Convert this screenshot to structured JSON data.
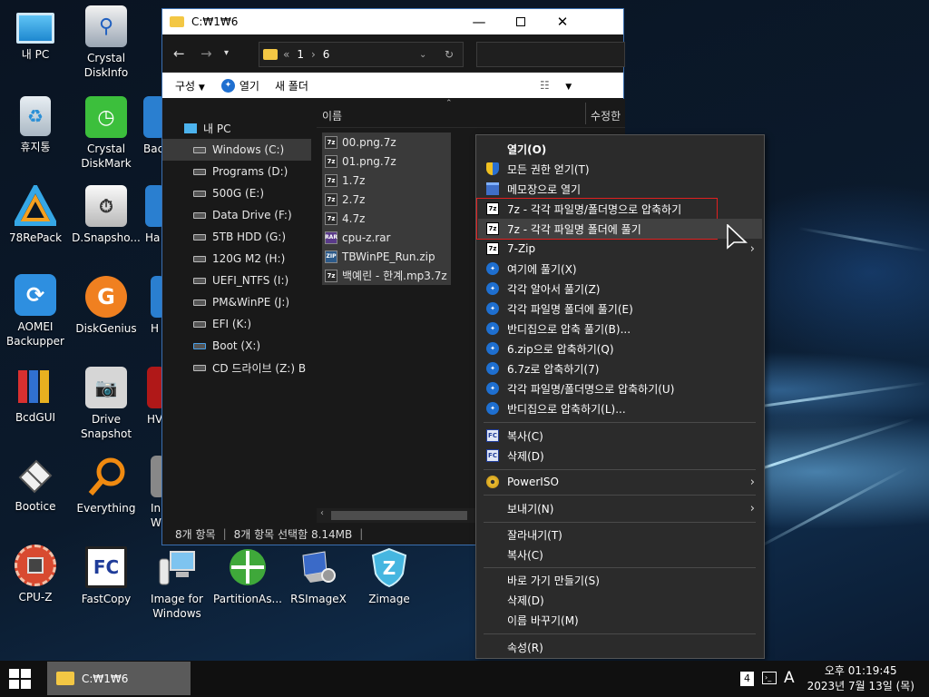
{
  "colors": {
    "accent": "#3b6fb0",
    "highlight_box": "#e02020",
    "menu_bg": "#2b2b2b",
    "selected_item": "#3a3a3a",
    "taskbar_item": "#5a5a5a"
  },
  "desktop_icons": [
    {
      "label": "내 PC",
      "icon": "monitor-icon"
    },
    {
      "label": "Crystal\nDiskInfo",
      "icon": "disk-magnifier-icon"
    },
    {
      "label": "휴지통",
      "icon": "recycle-bin-icon"
    },
    {
      "label": "Crystal\nDiskMark",
      "icon": "stopwatch-icon"
    },
    {
      "label": "78RePack",
      "icon": "triangle-logo-icon"
    },
    {
      "label": "D.Snapsho...",
      "icon": "drive-clock-icon"
    },
    {
      "label": "AOMEI\nBackupper",
      "icon": "sync-icon"
    },
    {
      "label": "DiskGenius",
      "icon": "g-logo-icon"
    },
    {
      "label": "BcdGUI",
      "icon": "binders-icon"
    },
    {
      "label": "Drive\nSnapshot",
      "icon": "camera-icon"
    },
    {
      "label": "Bootice",
      "icon": "eraser-icon"
    },
    {
      "label": "Everything",
      "icon": "magnifier-icon"
    },
    {
      "label": "CPU-Z",
      "icon": "cpu-chip-icon"
    },
    {
      "label": "FastCopy",
      "icon": "fc-logo-icon"
    },
    {
      "label": "Image for\nWindows",
      "icon": "computer-bottle-icon"
    },
    {
      "label": "PartitionAs...",
      "icon": "partition-icon"
    },
    {
      "label": "RSImageX",
      "icon": "laptop-gear-icon"
    },
    {
      "label": "Zimage",
      "icon": "shield-z-icon"
    }
  ],
  "partial_icons": [
    {
      "label": "Bac",
      "icon": "partial-icon"
    },
    {
      "label": "Ha",
      "icon": "partial-icon"
    },
    {
      "label": "H",
      "icon": "partial-icon"
    },
    {
      "label": "HV",
      "icon": "partial-icon"
    },
    {
      "label": "In\nW",
      "icon": "partial-icon"
    }
  ],
  "explorer": {
    "title": "C:₩1₩6",
    "address": {
      "prefix": "«",
      "crumb1": "1",
      "crumb2": "6"
    },
    "commands": {
      "organize": "구성",
      "open": "열기",
      "new_folder": "새 폴더"
    },
    "nav": {
      "root": "내 PC",
      "drives": [
        "Windows (C:)",
        "Programs (D:)",
        "500G (E:)",
        "Data Drive (F:)",
        "5TB HDD (G:)",
        "120G M2 (H:)",
        "UEFI_NTFS (I:)",
        "PM&WinPE (J:)",
        "EFI (K:)",
        "Boot (X:)",
        "CD 드라이브 (Z:) B"
      ]
    },
    "columns": {
      "name": "이름",
      "modified": "수정한"
    },
    "files": [
      {
        "name": "00.png.7z",
        "type": "7Z"
      },
      {
        "name": "01.png.7z",
        "type": "7Z"
      },
      {
        "name": "1.7z",
        "type": "7Z"
      },
      {
        "name": "2.7z",
        "type": "7Z"
      },
      {
        "name": "4.7z",
        "type": "7Z"
      },
      {
        "name": "cpu-z.rar",
        "type": "RAR"
      },
      {
        "name": "TBWinPE_Run.zip",
        "type": "ZIP"
      },
      {
        "name": "백예린 - 한계.mp3.7z",
        "type": "7Z"
      }
    ],
    "status": {
      "count": "8개 항목",
      "selection": "8개 항목 선택함 8.14MB"
    }
  },
  "context_menu": {
    "items": [
      {
        "label": "열기(O)",
        "icon": "",
        "bold": true
      },
      {
        "label": "모든 권한 얻기(T)",
        "icon": "uac-shield-icon"
      },
      {
        "label": "메모장으로 열기",
        "icon": "notepad-icon"
      },
      {
        "label": "7z - 각각 파일명/폴더명으로 압축하기",
        "icon": "7z-icon"
      },
      {
        "label": "7z - 각각 파일명 폴더에 풀기",
        "icon": "7z-icon"
      },
      {
        "label": "7-Zip",
        "icon": "7z-icon"
      },
      {
        "label": "여기에 풀기(X)",
        "icon": "bandizip-icon"
      },
      {
        "label": "각각 알아서 풀기(Z)",
        "icon": "bandizip-icon"
      },
      {
        "label": "각각 파일명 폴더에 풀기(E)",
        "icon": "bandizip-icon"
      },
      {
        "label": "반디집으로 압축 풀기(B)...",
        "icon": "bandizip-icon"
      },
      {
        "label": "6.zip으로 압축하기(Q)",
        "icon": "bandizip-icon"
      },
      {
        "label": "6.7z로 압축하기(7)",
        "icon": "bandizip-icon"
      },
      {
        "label": "각각 파일명/폴더명으로 압축하기(U)",
        "icon": "bandizip-icon"
      },
      {
        "label": "반디집으로 압축하기(L)...",
        "icon": "bandizip-icon"
      },
      {
        "label": "복사(C)",
        "icon": "fastcopy-icon"
      },
      {
        "label": "삭제(D)",
        "icon": "fastcopy-icon"
      },
      {
        "label": "PowerISO",
        "icon": "poweriso-icon"
      },
      {
        "label": "보내기(N)",
        "icon": ""
      },
      {
        "label": "잘라내기(T)",
        "icon": ""
      },
      {
        "label": "복사(C)",
        "icon": ""
      },
      {
        "label": "바로 가기 만들기(S)",
        "icon": ""
      },
      {
        "label": "삭제(D)",
        "icon": ""
      },
      {
        "label": "이름 바꾸기(M)",
        "icon": ""
      },
      {
        "label": "속성(R)",
        "icon": ""
      }
    ],
    "icon_text": {
      "sevenzip": "7z",
      "bandizip": "✦",
      "fastcopy": "FC"
    }
  },
  "taskbar": {
    "task_title": "C:₩1₩6",
    "tray": {
      "badge": "4",
      "ime": "A"
    },
    "clock": {
      "time": "오후 01:19:45",
      "date": "2023년 7월 13일 (목)"
    }
  },
  "file_type_labels": {
    "sevenzip": "7z",
    "rar": "RAR",
    "zip": "ZIP"
  }
}
